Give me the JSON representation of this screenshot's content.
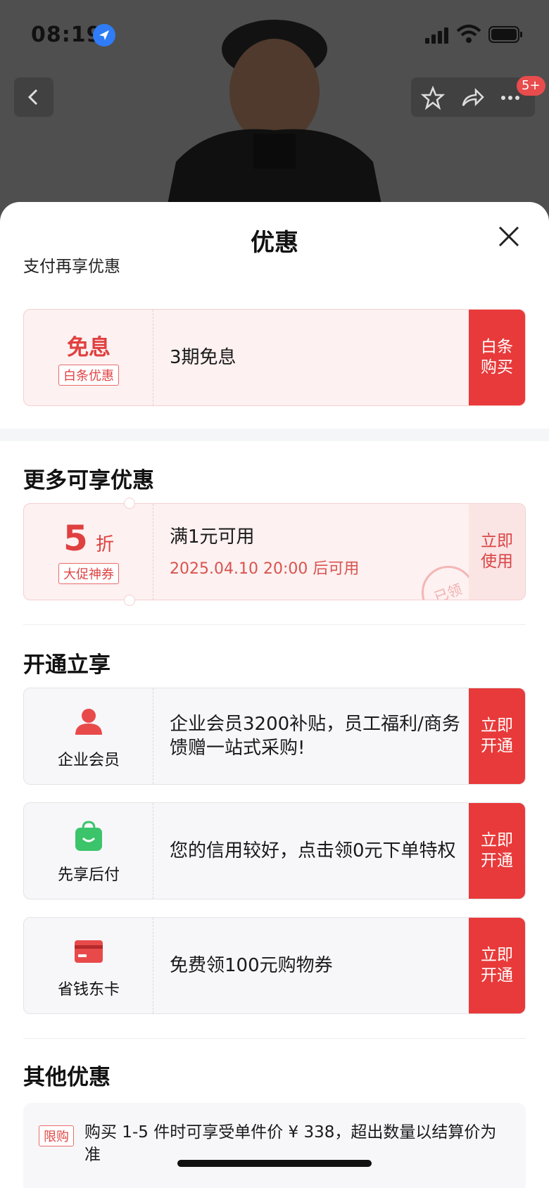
{
  "status_bar": {
    "time": "08:19"
  },
  "nav": {
    "badge": "5+"
  },
  "sheet": {
    "title": "优惠",
    "pay_section": {
      "label": "支付再享优惠",
      "card": {
        "left_title": "免息",
        "left_tag": "白条优惠",
        "text": "3期免息",
        "action": "白条\n购买"
      }
    },
    "more_section": {
      "title": "更多可享优惠",
      "card": {
        "discount_number": "5",
        "discount_unit": "折",
        "left_tag": "大促神券",
        "text": "满1元可用",
        "sub_text": "2025.04.10 20:00 后可用",
        "action": "立即\n使用",
        "stamp": "已领"
      }
    },
    "open_section": {
      "title": "开通立享",
      "cards": [
        {
          "label": "企业会员",
          "icon": "user-icon",
          "text": "企业会员3200补贴，员工福利/商务馈赠一站式采购!",
          "action": "立即\n开通"
        },
        {
          "label": "先享后付",
          "icon": "shopping-bag-icon",
          "text": "您的信用较好，点击领0元下单特权",
          "action": "立即\n开通"
        },
        {
          "label": "省钱东卡",
          "icon": "card-icon",
          "text": "免费领100元购物券",
          "action": "立即\n开通"
        }
      ]
    },
    "other_section": {
      "title": "其他优惠",
      "tag": "限购",
      "text": "购买 1-5 件时可享受单件价 ¥ 338，超出数量以结算价为准"
    }
  },
  "colors": {
    "accent_red": "#e83a3a",
    "pink_bg": "#fdf1f1",
    "text_red": "#e0403f"
  }
}
